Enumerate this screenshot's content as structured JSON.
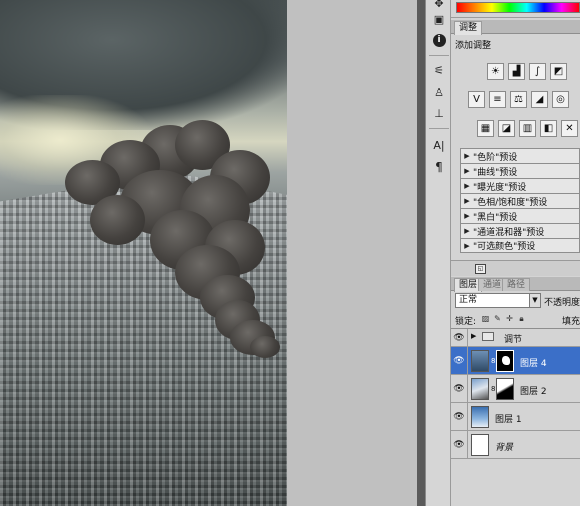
{
  "adjustments_panel": {
    "tabs": [
      "调整"
    ],
    "heading": "添加调整",
    "row1_icons": [
      "brightness-contrast-icon",
      "levels-icon",
      "curves-icon",
      "exposure-icon"
    ],
    "row2_icons": [
      "vibrance-icon",
      "hue-saturation-icon",
      "color-balance-icon",
      "black-white-icon",
      "photo-filter-icon"
    ],
    "row3_icons": [
      "channel-mixer-icon",
      "invert-icon",
      "posterize-icon",
      "threshold-icon",
      "gradient-map-icon"
    ],
    "presets": [
      {
        "label": "\"色阶\"预设"
      },
      {
        "label": "\"曲线\"预设"
      },
      {
        "label": "\"曝光度\"预设"
      },
      {
        "label": "\"色相/饱和度\"预设"
      },
      {
        "label": "\"黑白\"预设"
      },
      {
        "label": "\"通道混和器\"预设"
      },
      {
        "label": "\"可选颜色\"预设"
      }
    ]
  },
  "layers_panel": {
    "tabs": [
      {
        "label": "图层",
        "active": true
      },
      {
        "label": "通道",
        "active": false
      },
      {
        "label": "路径",
        "active": false
      }
    ],
    "blend_mode": "正常",
    "opacity_label": "不透明度",
    "lock_label": "锁定:",
    "fill_label": "填充",
    "layers": [
      {
        "name": "调节",
        "type": "group",
        "selected": false
      },
      {
        "name": "图层 4",
        "type": "masked",
        "selected": true
      },
      {
        "name": "图层 2",
        "type": "masked",
        "selected": false
      },
      {
        "name": "图层 1",
        "type": "image",
        "selected": false
      },
      {
        "name": "背景",
        "type": "background",
        "selected": false
      }
    ]
  },
  "dock_icons": [
    "histogram-icon",
    "navigator-icon",
    "info-icon",
    "brushes-icon",
    "clone-source-icon",
    "tool-presets-icon",
    "character-icon",
    "paragraph-icon"
  ],
  "colors": {
    "selection": "#3b6fc8",
    "panel_bg": "#d4d4d4",
    "workspace": "#c0c0c0"
  }
}
